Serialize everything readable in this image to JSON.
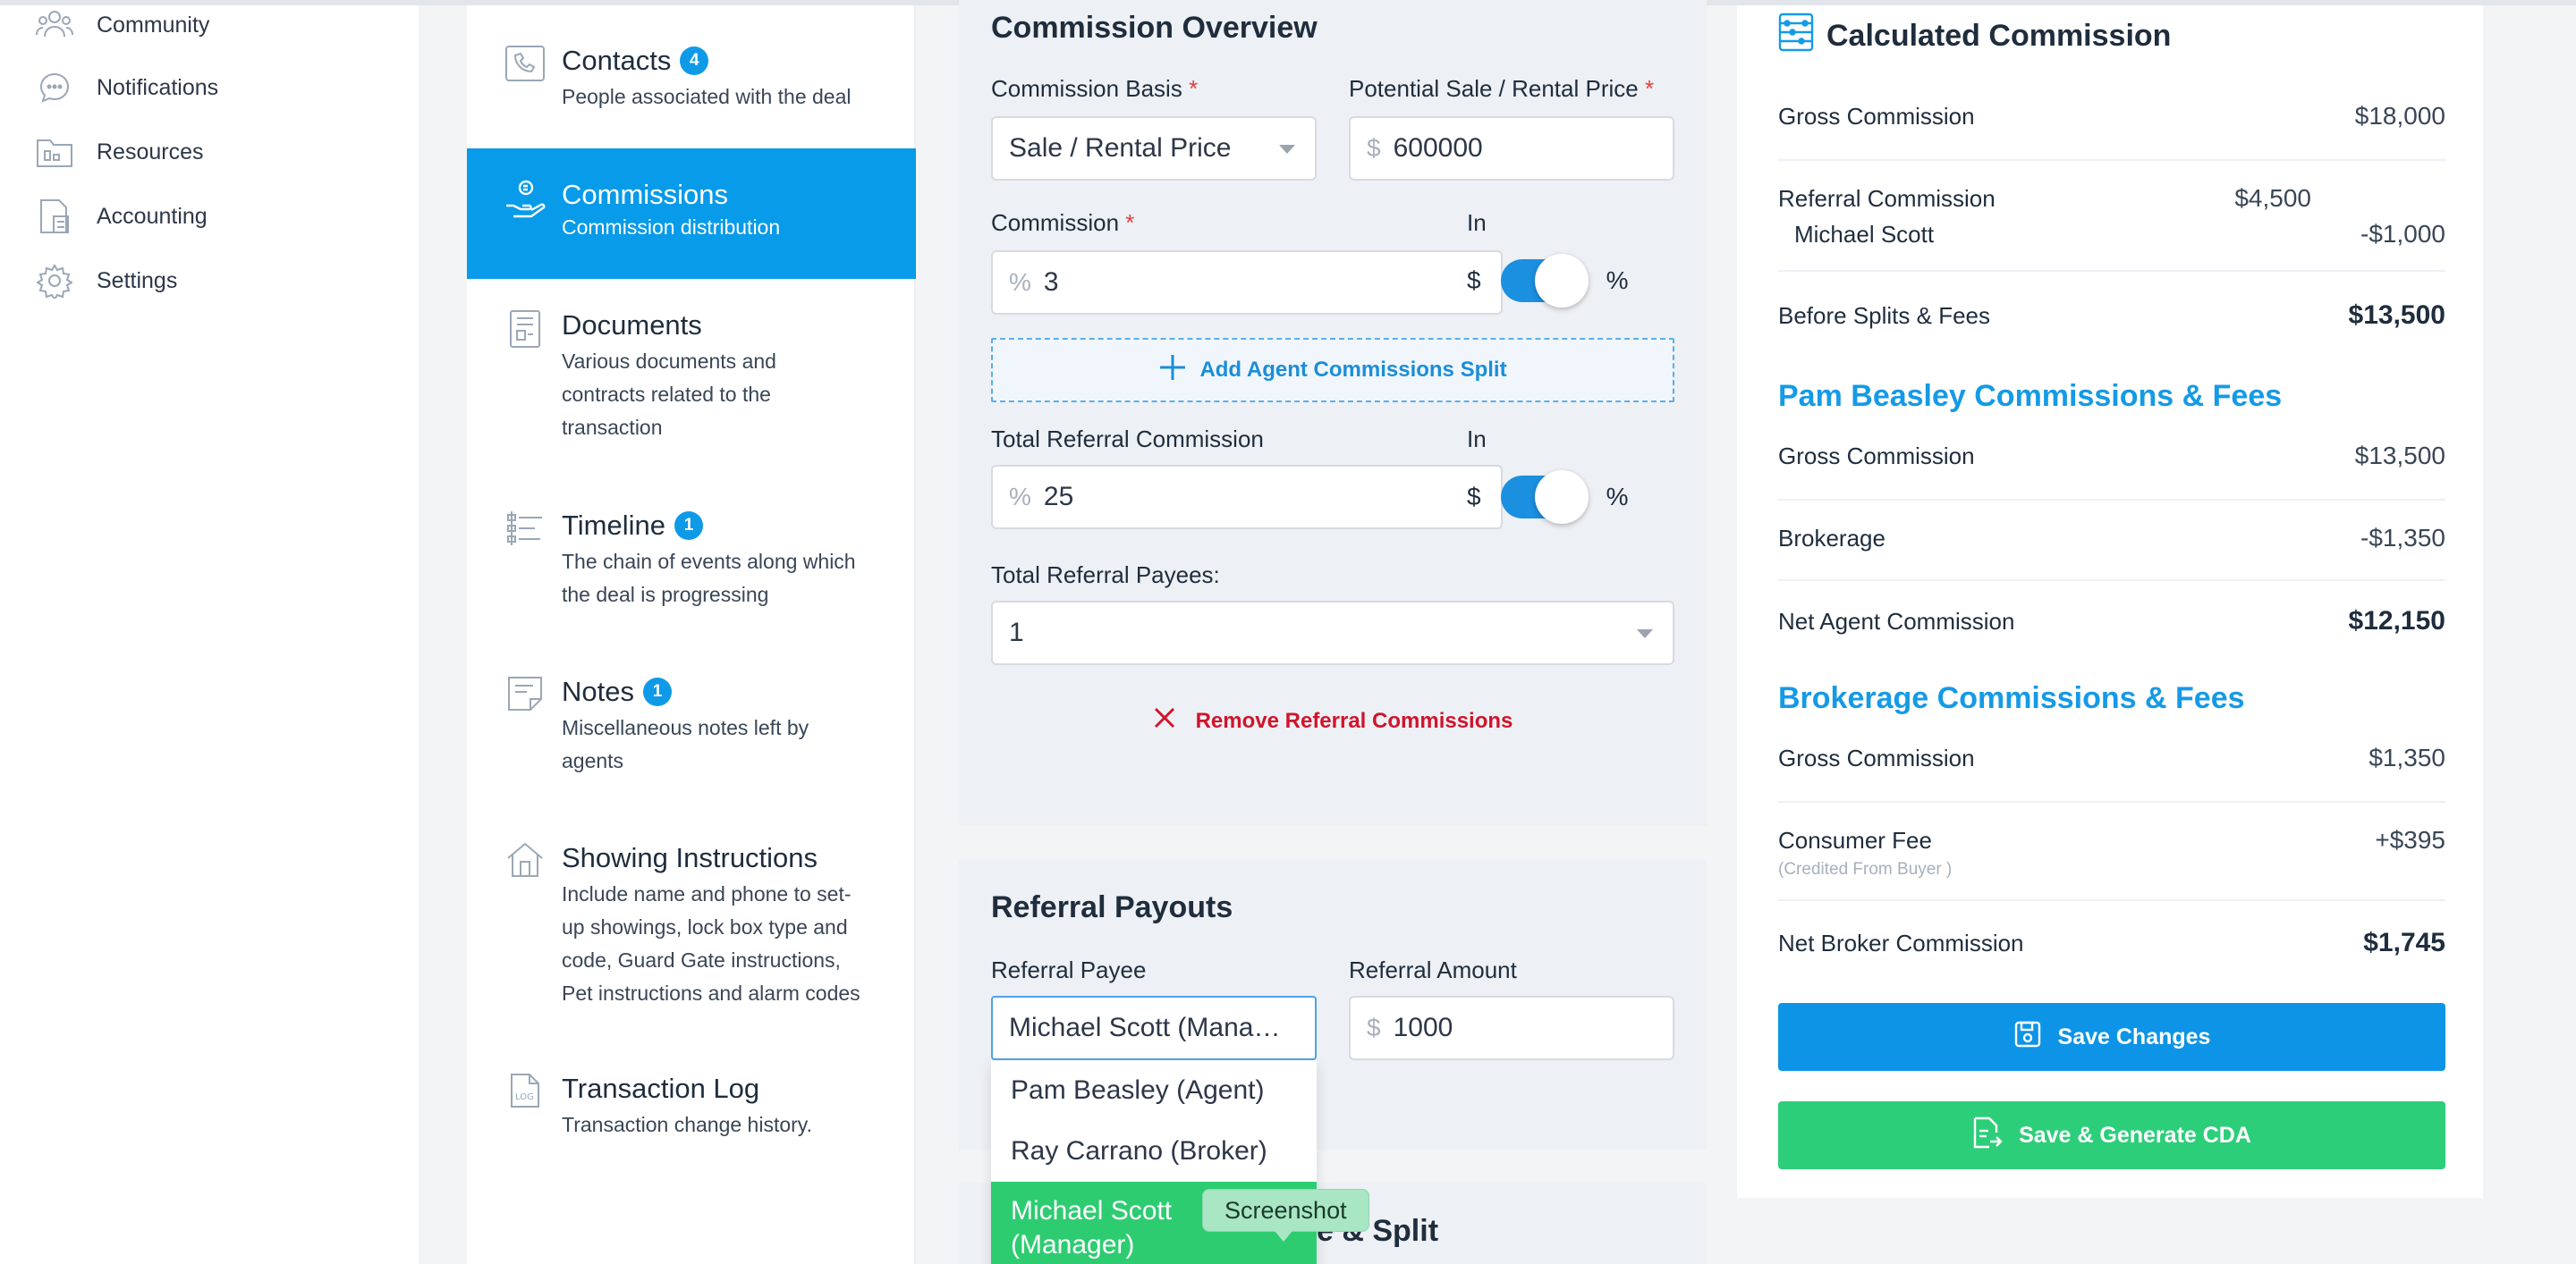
{
  "sidebar": {
    "items": [
      {
        "label": "Community",
        "icon": "community-icon"
      },
      {
        "label": "Notifications",
        "icon": "chat-bubble-icon"
      },
      {
        "label": "Resources",
        "icon": "folder-icon"
      },
      {
        "label": "Accounting",
        "icon": "calculator-icon"
      },
      {
        "label": "Settings",
        "icon": "gear-icon"
      }
    ]
  },
  "steps": [
    {
      "title": "Contacts",
      "badge": "4",
      "desc": [
        "People associated with the deal"
      ],
      "icon": "phone-book-icon"
    },
    {
      "title": "Commissions",
      "badge": "",
      "desc": [
        "Commission distribution"
      ],
      "icon": "hand-money-icon",
      "active": true
    },
    {
      "title": "Documents",
      "badge": "",
      "desc": [
        "Various documents and",
        "contracts related to the",
        "transaction"
      ],
      "icon": "document-icon"
    },
    {
      "title": "Timeline",
      "badge": "1",
      "desc": [
        "The chain of events along which",
        "the deal is progressing"
      ],
      "icon": "timeline-icon"
    },
    {
      "title": "Notes",
      "badge": "1",
      "desc": [
        "Miscellaneous notes left by",
        "agents"
      ],
      "icon": "note-icon"
    },
    {
      "title": "Showing Instructions",
      "badge": "",
      "desc": [
        "Include name and phone to set-",
        "up showings, lock box type and",
        "code, Guard Gate instructions,",
        "Pet instructions and alarm codes"
      ],
      "icon": "house-icon"
    },
    {
      "title": "Transaction Log",
      "badge": "",
      "desc": [
        "Transaction change history."
      ],
      "icon": "log-icon"
    }
  ],
  "overview": {
    "title": "Commission Overview",
    "basis_label": "Commission Basis",
    "basis_value": "Sale / Rental Price",
    "price_label": "Potential Sale / Rental Price",
    "price_prefix": "$",
    "price_value": "600000",
    "commission_label": "Commission",
    "commission_prefix": "%",
    "commission_value": "3",
    "in_label": "In",
    "dollar": "$",
    "percent": "%",
    "add_split_label": "Add Agent Commissions Split",
    "referral_label": "Total Referral Commission",
    "referral_prefix": "%",
    "referral_value": "25",
    "payees_label": "Total Referral Payees:",
    "payees_value": "1",
    "remove_label": "Remove Referral Commissions"
  },
  "payouts": {
    "title": "Referral Payouts",
    "payee_label": "Referral Payee",
    "payee_value": "Michael Scott (Mana…",
    "amount_label": "Referral Amount",
    "amount_prefix": "$",
    "amount_value": "1000",
    "options": [
      "Pam Beasley (Agent)",
      "Ray Carrano (Broker)"
    ],
    "selected_option_line1": "Michael Scott",
    "selected_option_line2": "(Manager)",
    "hidden_section_fragment": "e & Split"
  },
  "tooltip": "Screenshot",
  "calc": {
    "title": "Calculated Commission",
    "gross_label": "Gross Commission",
    "gross_value": "$18,000",
    "referral_label": "Referral Commission",
    "referral_value": "$4,500",
    "referral_person": "Michael Scott",
    "referral_person_value": "-$1,000",
    "before_label": "Before Splits & Fees",
    "before_value": "$13,500",
    "agent_title": "Pam Beasley Commissions & Fees",
    "agent_gross_label": "Gross Commission",
    "agent_gross_value": "$13,500",
    "brokerage_label": "Brokerage",
    "brokerage_value": "-$1,350",
    "net_agent_label": "Net Agent Commission",
    "net_agent_value": "$12,150",
    "broker_title": "Brokerage Commissions & Fees",
    "broker_gross_label": "Gross Commission",
    "broker_gross_value": "$1,350",
    "consumer_label": "Consumer Fee",
    "consumer_note": "(Credited From Buyer )",
    "consumer_value": "+$395",
    "net_broker_label": "Net Broker Commission",
    "net_broker_value": "$1,745",
    "save_label": "Save Changes",
    "generate_label": "Save & Generate CDA"
  },
  "colors": {
    "accent": "#079be9",
    "success": "#2dce7a",
    "danger": "#d0142c"
  }
}
